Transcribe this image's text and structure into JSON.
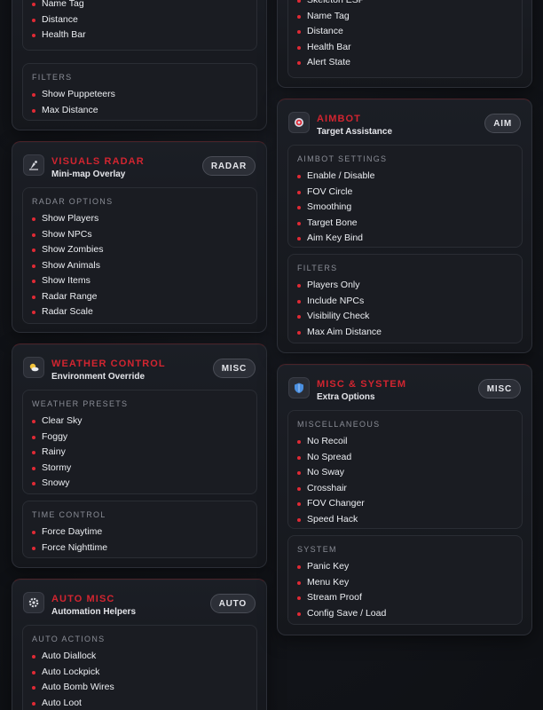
{
  "left_cards": [
    {
      "key": "visuals-esp-top",
      "title": "",
      "subtitle": "",
      "badge": "",
      "icon": "",
      "sections": [
        {
          "title": "",
          "items": [
            "Name Tag",
            "Distance",
            "Health Bar"
          ]
        },
        {
          "title": "FILTERS",
          "items": [
            "Show Puppeteers",
            "Max Distance"
          ]
        }
      ]
    },
    {
      "key": "visuals-radar",
      "title": "VISUALS RADAR",
      "subtitle": "Mini-map Overlay",
      "badge": "RADAR",
      "icon": "radar-icon",
      "sections": [
        {
          "title": "RADAR OPTIONS",
          "items": [
            "Show Players",
            "Show NPCs",
            "Show Zombies",
            "Show Animals",
            "Show Items",
            "Radar Range",
            "Radar Scale"
          ]
        }
      ]
    },
    {
      "key": "weather-control",
      "title": "WEATHER CONTROL",
      "subtitle": "Environment Override",
      "badge": "MISC",
      "icon": "weather-icon",
      "sections": [
        {
          "title": "WEATHER PRESETS",
          "items": [
            "Clear Sky",
            "Foggy",
            "Rainy",
            "Stormy",
            "Snowy"
          ]
        },
        {
          "title": "TIME CONTROL",
          "items": [
            "Force Daytime",
            "Force Nighttime"
          ]
        }
      ]
    },
    {
      "key": "auto-misc",
      "title": "AUTO MISC",
      "subtitle": "Automation Helpers",
      "badge": "AUTO",
      "icon": "gear-icon",
      "sections": [
        {
          "title": "AUTO ACTIONS",
          "items": [
            "Auto Diallock",
            "Auto Lockpick",
            "Auto Bomb Wires",
            "Auto Loot"
          ]
        }
      ]
    }
  ],
  "right_cards": [
    {
      "key": "npc-esp-top",
      "title": "",
      "subtitle": "",
      "badge": "",
      "icon": "",
      "sections": [
        {
          "title": "",
          "items": [
            "Skeleton ESP",
            "Name Tag",
            "Distance",
            "Health Bar",
            "Alert State"
          ]
        }
      ]
    },
    {
      "key": "aimbot",
      "title": "AIMBOT",
      "subtitle": "Target Assistance",
      "badge": "AIM",
      "icon": "target-icon",
      "sections": [
        {
          "title": "AIMBOT SETTINGS",
          "items": [
            "Enable / Disable",
            "FOV Circle",
            "Smoothing",
            "Target Bone",
            "Aim Key Bind"
          ]
        },
        {
          "title": "FILTERS",
          "items": [
            "Players Only",
            "Include NPCs",
            "Visibility Check",
            "Max Aim Distance"
          ]
        }
      ]
    },
    {
      "key": "misc-system",
      "title": "MISC & SYSTEM",
      "subtitle": "Extra Options",
      "badge": "MISC",
      "icon": "shield-icon",
      "sections": [
        {
          "title": "MISCELLANEOUS",
          "items": [
            "No Recoil",
            "No Spread",
            "No Sway",
            "Crosshair",
            "FOV Changer",
            "Speed Hack"
          ]
        },
        {
          "title": "SYSTEM",
          "items": [
            "Panic Key",
            "Menu Key",
            "Stream Proof",
            "Config Save / Load"
          ]
        }
      ]
    }
  ],
  "colors": {
    "accent": "#d22530",
    "bullet": "#e02a35",
    "card_bg": "#1b1e25",
    "section_bg": "#1a1c22",
    "page_bg": "#121419"
  }
}
